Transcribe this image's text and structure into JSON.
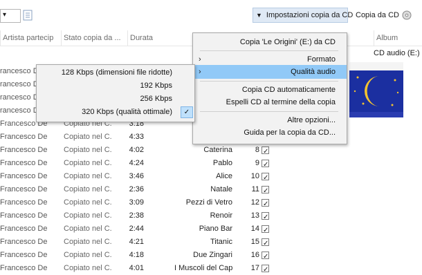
{
  "toolbar": {
    "import_settings_label": "Impostazioni copia da CD",
    "copy_cd_label": "Copia da CD"
  },
  "headers": {
    "contributing_artist": "Artista partecip",
    "status": "Stato copia da ...",
    "duration": "Durata",
    "album": "Album"
  },
  "album": {
    "label": "CD audio (E:)"
  },
  "rows": [
    {
      "artist": "rancesco De",
      "status": "",
      "duration": "",
      "title": "",
      "num": ""
    },
    {
      "artist": "rancesco De",
      "status": "",
      "duration": "",
      "title": "",
      "num": ""
    },
    {
      "artist": "rancesco De",
      "status": "",
      "duration": "",
      "title": "",
      "num": ""
    },
    {
      "artist": "rancesco De",
      "status": "",
      "duration": "",
      "title": "",
      "num": ""
    },
    {
      "artist": "Francesco De",
      "status": "Copiato nel C...",
      "duration": "3:18",
      "title": "",
      "num": ""
    },
    {
      "artist": "Francesco De",
      "status": "Copiato nel C...",
      "duration": "4:33",
      "title": "",
      "num": ""
    },
    {
      "artist": "Francesco De",
      "status": "Copiato nel C...",
      "duration": "4:02",
      "title": "Caterina",
      "num": "8"
    },
    {
      "artist": "Francesco De",
      "status": "Copiato nel C...",
      "duration": "4:24",
      "title": "Pablo",
      "num": "9"
    },
    {
      "artist": "Francesco De",
      "status": "Copiato nel C...",
      "duration": "3:46",
      "title": "Alice",
      "num": "10"
    },
    {
      "artist": "Francesco De",
      "status": "Copiato nel C...",
      "duration": "2:36",
      "title": "Natale",
      "num": "11"
    },
    {
      "artist": "Francesco De",
      "status": "Copiato nel C...",
      "duration": "3:09",
      "title": "Pezzi di Vetro",
      "num": "12"
    },
    {
      "artist": "Francesco De",
      "status": "Copiato nel C...",
      "duration": "2:38",
      "title": "Renoir",
      "num": "13"
    },
    {
      "artist": "Francesco De",
      "status": "Copiato nel C...",
      "duration": "2:44",
      "title": "Piano Bar",
      "num": "14"
    },
    {
      "artist": "Francesco De",
      "status": "Copiato nel C...",
      "duration": "4:21",
      "title": "Titanic",
      "num": "15"
    },
    {
      "artist": "Francesco De",
      "status": "Copiato nel C...",
      "duration": "4:18",
      "title": "Due Zingari",
      "num": "16"
    },
    {
      "artist": "Francesco De",
      "status": "Copiato nel C...",
      "duration": "4:01",
      "title": "I Muscoli del Capitano",
      "num": "17"
    }
  ],
  "main_menu": {
    "copy_cd": "Copia 'Le Origini' (E:) da CD",
    "format": "Formato",
    "audio_quality": "Qualità audio",
    "auto_copy": "Copia CD automaticamente",
    "eject": "Espelli CD al termine della copia",
    "more_options": "Altre opzioni...",
    "help": "Guida per la copia da CD..."
  },
  "sub_menu": {
    "items": [
      {
        "label": "128 Kbps (dimensioni file ridotte)"
      },
      {
        "label": "192 Kbps"
      },
      {
        "label": "256 Kbps"
      },
      {
        "label": "320 Kbps (qualità ottimale)"
      }
    ]
  },
  "colors": {
    "highlight": "#91c9f7",
    "toolbar_button": "#dfe9f5",
    "album_blue": "#1b2fa0",
    "moon": "#f2c230"
  }
}
